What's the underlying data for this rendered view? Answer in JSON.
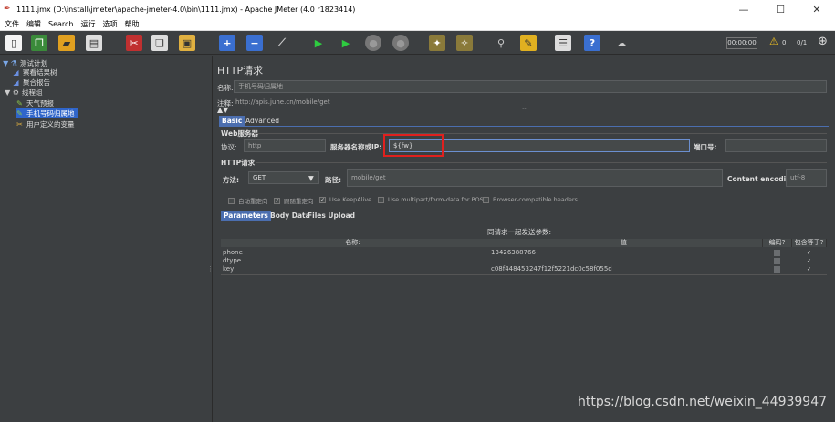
{
  "window": {
    "title": "1111.jmx (D:\\install\\jmeter\\apache-jmeter-4.0\\bin\\1111.jmx) - Apache JMeter (4.0 r1823414)",
    "minimize": "—",
    "maximize": "☐",
    "close": "✕"
  },
  "menu": [
    "文件",
    "编辑",
    "Search",
    "运行",
    "选项",
    "帮助"
  ],
  "toolbar": {
    "timer": "00:00:00",
    "warn_count": "0",
    "threads": "0/1"
  },
  "tree": [
    {
      "label": "测试计划",
      "icon": "test-plan-icon",
      "glyph": "▼ ⚗"
    },
    {
      "label": "察看结果树",
      "icon": "result-tree-icon",
      "glyph": "◢"
    },
    {
      "label": "聚合报告",
      "icon": "aggregate-report-icon",
      "glyph": "◢"
    },
    {
      "label": "线程组",
      "icon": "thread-group-icon",
      "glyph": "▼ ⚙"
    },
    {
      "label": "天气预报",
      "icon": "sampler-icon",
      "glyph": "✎"
    },
    {
      "label": "手机号码归属地",
      "icon": "sampler-icon",
      "glyph": "✎"
    },
    {
      "label": "用户定义的变量",
      "icon": "variables-icon",
      "glyph": "✂"
    }
  ],
  "panel": {
    "title": "HTTP请求",
    "name_label": "名称:",
    "name_value": "手机号码归属地",
    "comment_label": "注释:",
    "comment_value": "http://apis.juhe.cn/mobile/get",
    "tabs": [
      "Basic",
      "Advanced"
    ],
    "web_server_label": "Web服务器",
    "protocol_label": "协议:",
    "protocol_value": "http",
    "server_label": "服务器名称或IP:",
    "server_value": "${fw}",
    "port_label": "端口号:",
    "port_value": "",
    "http_request_label": "HTTP请求",
    "method_label": "方法:",
    "method_value": "GET",
    "path_label": "路径:",
    "path_value": "mobile/get",
    "encoding_label": "Content encoding:",
    "encoding_value": "utf-8",
    "options": [
      {
        "label": "自动重定向",
        "checked": false
      },
      {
        "label": "跟随重定向",
        "checked": true
      },
      {
        "label": "Use KeepAlive",
        "checked": true
      },
      {
        "label": "Use multipart/form-data for POST",
        "checked": false
      },
      {
        "label": "Browser-compatible headers",
        "checked": false
      }
    ],
    "param_tabs": [
      "Parameters",
      "Body Data",
      "Files Upload"
    ],
    "send_label": "同请求一起发送参数:",
    "columns": [
      "名称:",
      "值",
      "编码?",
      "包含等于?"
    ],
    "params": [
      {
        "name": "phone",
        "value": "13426388766"
      },
      {
        "name": "dtype",
        "value": ""
      },
      {
        "name": "key",
        "value": "c08f448453247f12f5221dc0c58f055d"
      }
    ]
  },
  "watermark": "https://blog.csdn.net/weixin_44939947"
}
